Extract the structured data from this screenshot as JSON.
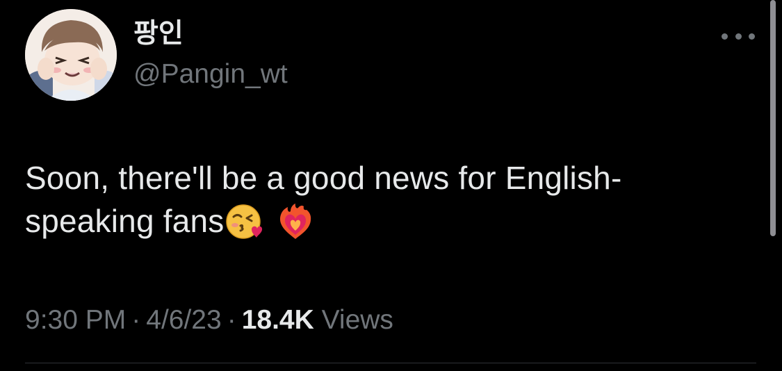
{
  "author": {
    "display_name": "팡인",
    "handle": "@Pangin_wt",
    "avatar_icon": "avatar-illustration"
  },
  "more_icon": "ellipsis-icon",
  "tweet": {
    "line1": "Soon, there'll be a good news for English-",
    "line2": "speaking fans",
    "emojis": [
      "kissing-heart-emoji",
      "heart-on-fire-emoji"
    ]
  },
  "meta": {
    "time": "9:30 PM",
    "separator": "·",
    "date": "4/6/23",
    "views_count": "18.4K",
    "views_label": "Views"
  },
  "colors": {
    "background": "#000000",
    "primary_text": "#e7e9ea",
    "secondary_text": "#71767b",
    "divider": "#2f3336"
  }
}
